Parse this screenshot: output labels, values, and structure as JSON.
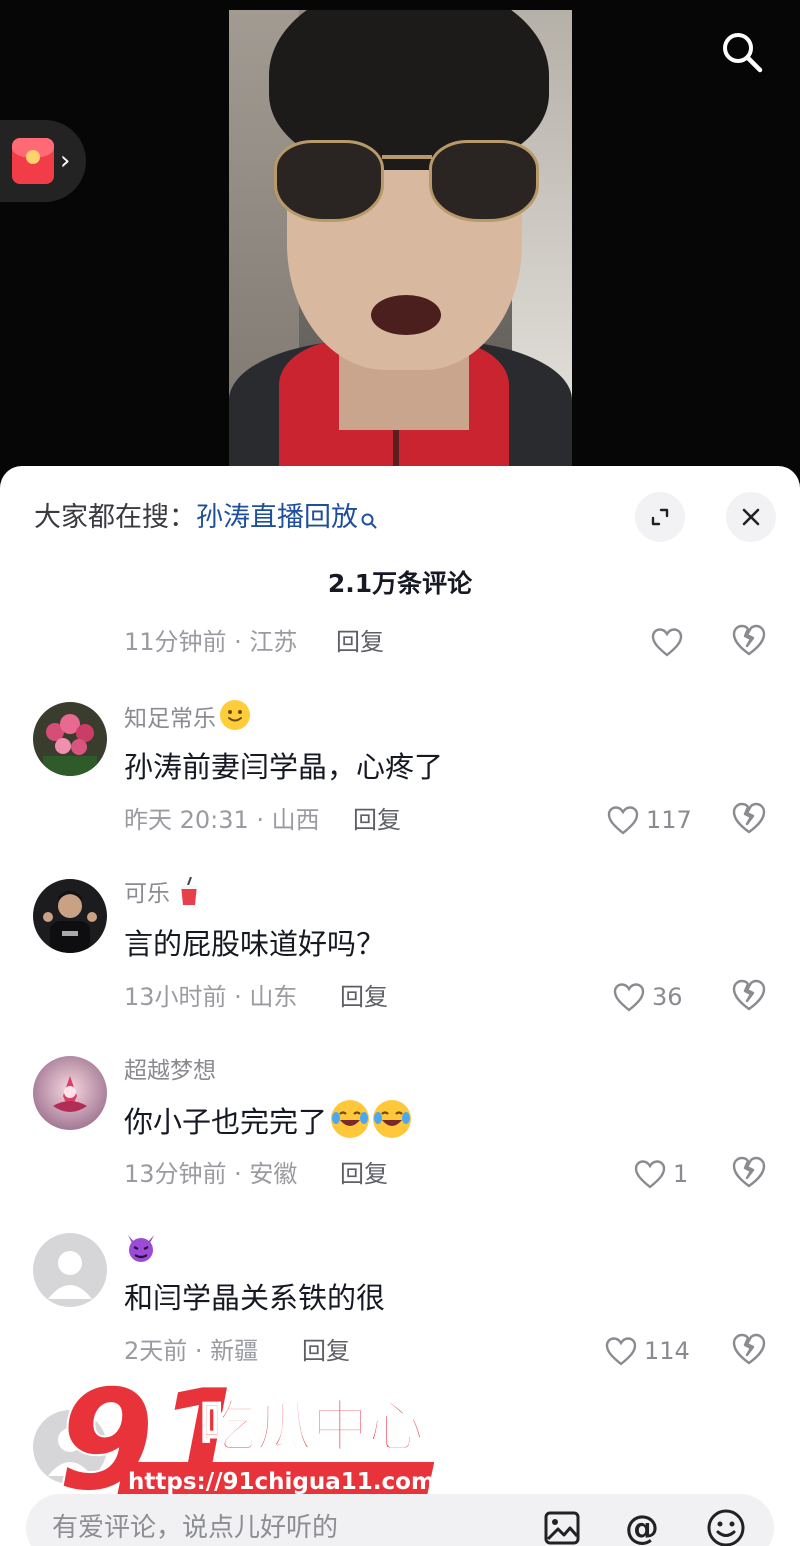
{
  "video": {
    "search_icon": "search-icon",
    "redpacket_icon": "red-envelope-icon"
  },
  "sheet": {
    "hot_prefix": "大家都在搜：",
    "hot_query": "孙涛直播回放",
    "comment_count": "2.1万条评论",
    "reply_label": "回复"
  },
  "partial_comment": {
    "meta": "11分钟前 · 江苏"
  },
  "comments": [
    {
      "user": "知足常乐",
      "text": "孙涛前妻闫学晶，心疼了",
      "meta": "昨天 20:31 · 山西",
      "likes": "117"
    },
    {
      "user": "可乐",
      "text": "言的屁股味道好吗？",
      "meta": "13小时前 · 山东",
      "likes": "36"
    },
    {
      "user": "超越梦想",
      "text": "你小子也完完了",
      "meta": "13分钟前 · 安徽",
      "likes": "1"
    },
    {
      "user": "",
      "text": "和闫学晶关系铁的很",
      "meta": "2天前 · 新疆",
      "likes": "114"
    }
  ],
  "input": {
    "placeholder": "有爱评论，说点儿好听的"
  },
  "watermark": {
    "number": "91",
    "brand": "吃瓜中心",
    "url": "https://91chigua11.com"
  },
  "colors": {
    "accent_link": "#1f4f9c",
    "watermark_red": "#e8333b"
  }
}
